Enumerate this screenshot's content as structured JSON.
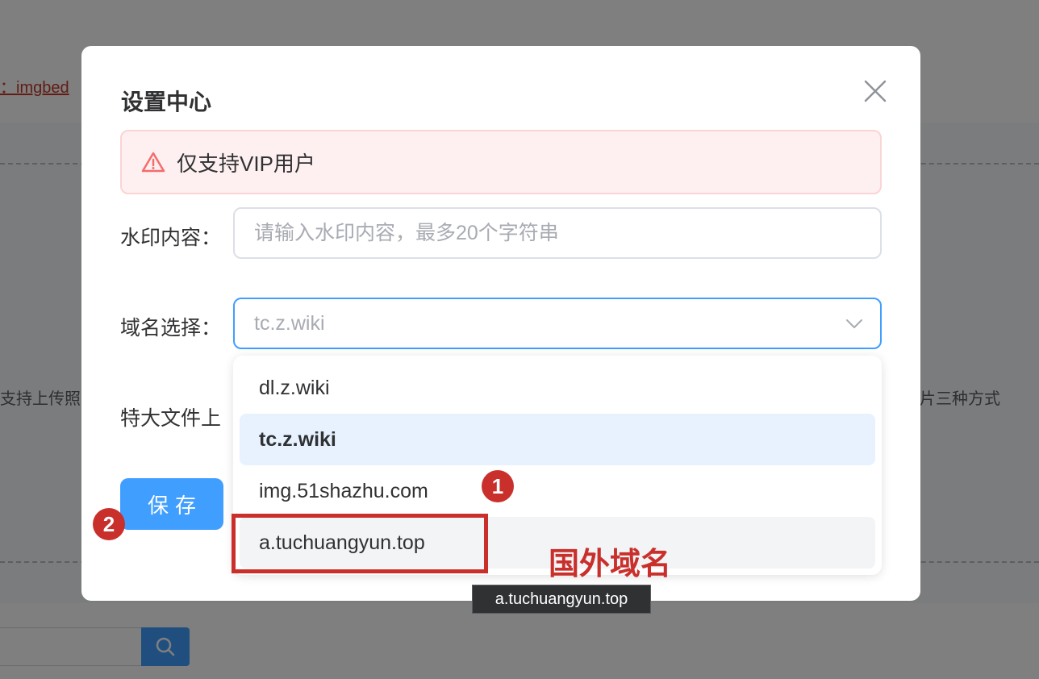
{
  "background": {
    "link_text": "：imgbed",
    "left_text": "支持上传照",
    "right_text": "片三种方式",
    "search_icon": "search-icon"
  },
  "dialog": {
    "title": "设置中心",
    "close_icon": "close-icon",
    "alert": {
      "icon": "warning-triangle-icon",
      "text": "仅支持VIP用户",
      "color": "#f56c6c"
    },
    "watermark": {
      "label": "水印内容：",
      "placeholder": "请输入水印内容，最多20个字符串",
      "value": ""
    },
    "domain": {
      "label": "域名选择：",
      "selected": "tc.z.wiki",
      "arrow_icon": "chevron-down-icon"
    },
    "bigfile": {
      "label": "特大文件上"
    },
    "save_label": "保存",
    "accent_color": "#409eff"
  },
  "dropdown": {
    "options": [
      {
        "label": "dl.z.wiki",
        "state": "normal"
      },
      {
        "label": "tc.z.wiki",
        "state": "selected"
      },
      {
        "label": "img.51shazhu.com",
        "state": "normal"
      },
      {
        "label": "a.tuchuangyun.top",
        "state": "hover"
      }
    ]
  },
  "tooltip": {
    "text": "a.tuchuangyun.top"
  },
  "annotations": {
    "marker_1": "1",
    "marker_2": "2",
    "note": "国外域名",
    "color": "#c9302c"
  }
}
